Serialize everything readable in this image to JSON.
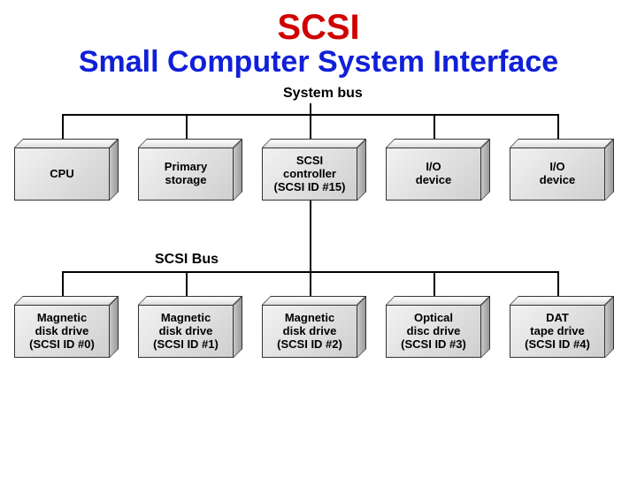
{
  "title": {
    "line1": "SCSI",
    "line2": "Small Computer System Interface"
  },
  "bus_labels": {
    "system": "System bus",
    "scsi": "SCSI Bus"
  },
  "system_boxes": [
    {
      "label": "CPU"
    },
    {
      "label": "Primary\nstorage"
    },
    {
      "label": "SCSI\ncontroller\n(SCSI ID #15)"
    },
    {
      "label": "I/O\ndevice"
    },
    {
      "label": "I/O\ndevice"
    }
  ],
  "scsi_boxes": [
    {
      "label": "Magnetic\ndisk drive\n(SCSI ID #0)"
    },
    {
      "label": "Magnetic\ndisk drive\n(SCSI ID #1)"
    },
    {
      "label": "Magnetic\ndisk drive\n(SCSI ID #2)"
    },
    {
      "label": "Optical\ndisc drive\n(SCSI ID #3)"
    },
    {
      "label": "DAT\ntape drive\n(SCSI ID #4)"
    }
  ]
}
